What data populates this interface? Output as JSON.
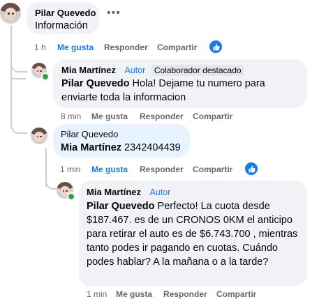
{
  "comments": [
    {
      "author": "Pilar Quevedo",
      "text": "Información",
      "time": "1 h",
      "like": "Me gusta",
      "reply": "Responder",
      "share": "Compartir",
      "more_icon": "more-dots-icon",
      "reaction_icon": "like-icon"
    },
    {
      "author": "Mia Martínez",
      "role": "Autor",
      "badge": "Colaborador destacado",
      "mention": "Pilar Quevedo",
      "text": " Hola! Dejame tu numero para enviarte toda la informacion",
      "time": "8 min",
      "like": "Me gusta",
      "reply": "Responder",
      "share": "Compartir"
    },
    {
      "author": "Pilar Quevedo",
      "mention": "Mia Martínez",
      "text": " 2342404439",
      "time": "1 min",
      "like": "Me gusta",
      "reply": "Responder",
      "share": "Compartir",
      "reaction_icon": "like-icon"
    },
    {
      "author": "Mia Martínez",
      "role": "Autor",
      "mention": "Pilar Quevedo",
      "text": " Perfecto! La cuota desde $187.467. es de un CRONOS 0KM el anticipo para retirar el auto es de $6.743.700 , mientras tanto podes ir pagando en cuotas. Cuándo podes hablar? A la mañana o a la tarde?",
      "time": "1 min",
      "like": "Me gusta",
      "reply": "Responder",
      "share": "Compartir"
    }
  ],
  "colors": {
    "accent": "#1877f2",
    "bubble": "#f0f2f5",
    "bubble_highlight": "#e7f3ff",
    "muted": "#65676b"
  }
}
